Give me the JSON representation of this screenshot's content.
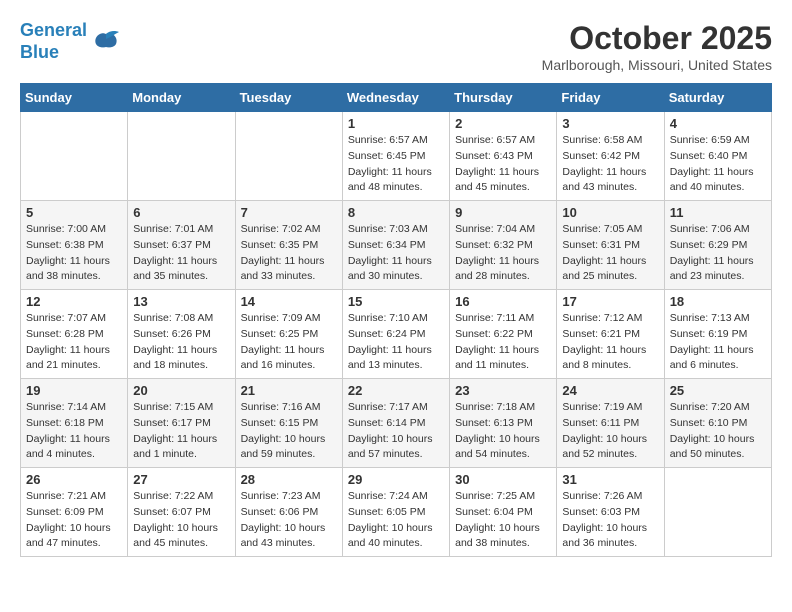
{
  "header": {
    "logo_line1": "General",
    "logo_line2": "Blue",
    "month": "October 2025",
    "location": "Marlborough, Missouri, United States"
  },
  "days_of_week": [
    "Sunday",
    "Monday",
    "Tuesday",
    "Wednesday",
    "Thursday",
    "Friday",
    "Saturday"
  ],
  "weeks": [
    [
      {
        "day": "",
        "info": ""
      },
      {
        "day": "",
        "info": ""
      },
      {
        "day": "",
        "info": ""
      },
      {
        "day": "1",
        "info": "Sunrise: 6:57 AM\nSunset: 6:45 PM\nDaylight: 11 hours\nand 48 minutes."
      },
      {
        "day": "2",
        "info": "Sunrise: 6:57 AM\nSunset: 6:43 PM\nDaylight: 11 hours\nand 45 minutes."
      },
      {
        "day": "3",
        "info": "Sunrise: 6:58 AM\nSunset: 6:42 PM\nDaylight: 11 hours\nand 43 minutes."
      },
      {
        "day": "4",
        "info": "Sunrise: 6:59 AM\nSunset: 6:40 PM\nDaylight: 11 hours\nand 40 minutes."
      }
    ],
    [
      {
        "day": "5",
        "info": "Sunrise: 7:00 AM\nSunset: 6:38 PM\nDaylight: 11 hours\nand 38 minutes."
      },
      {
        "day": "6",
        "info": "Sunrise: 7:01 AM\nSunset: 6:37 PM\nDaylight: 11 hours\nand 35 minutes."
      },
      {
        "day": "7",
        "info": "Sunrise: 7:02 AM\nSunset: 6:35 PM\nDaylight: 11 hours\nand 33 minutes."
      },
      {
        "day": "8",
        "info": "Sunrise: 7:03 AM\nSunset: 6:34 PM\nDaylight: 11 hours\nand 30 minutes."
      },
      {
        "day": "9",
        "info": "Sunrise: 7:04 AM\nSunset: 6:32 PM\nDaylight: 11 hours\nand 28 minutes."
      },
      {
        "day": "10",
        "info": "Sunrise: 7:05 AM\nSunset: 6:31 PM\nDaylight: 11 hours\nand 25 minutes."
      },
      {
        "day": "11",
        "info": "Sunrise: 7:06 AM\nSunset: 6:29 PM\nDaylight: 11 hours\nand 23 minutes."
      }
    ],
    [
      {
        "day": "12",
        "info": "Sunrise: 7:07 AM\nSunset: 6:28 PM\nDaylight: 11 hours\nand 21 minutes."
      },
      {
        "day": "13",
        "info": "Sunrise: 7:08 AM\nSunset: 6:26 PM\nDaylight: 11 hours\nand 18 minutes."
      },
      {
        "day": "14",
        "info": "Sunrise: 7:09 AM\nSunset: 6:25 PM\nDaylight: 11 hours\nand 16 minutes."
      },
      {
        "day": "15",
        "info": "Sunrise: 7:10 AM\nSunset: 6:24 PM\nDaylight: 11 hours\nand 13 minutes."
      },
      {
        "day": "16",
        "info": "Sunrise: 7:11 AM\nSunset: 6:22 PM\nDaylight: 11 hours\nand 11 minutes."
      },
      {
        "day": "17",
        "info": "Sunrise: 7:12 AM\nSunset: 6:21 PM\nDaylight: 11 hours\nand 8 minutes."
      },
      {
        "day": "18",
        "info": "Sunrise: 7:13 AM\nSunset: 6:19 PM\nDaylight: 11 hours\nand 6 minutes."
      }
    ],
    [
      {
        "day": "19",
        "info": "Sunrise: 7:14 AM\nSunset: 6:18 PM\nDaylight: 11 hours\nand 4 minutes."
      },
      {
        "day": "20",
        "info": "Sunrise: 7:15 AM\nSunset: 6:17 PM\nDaylight: 11 hours\nand 1 minute."
      },
      {
        "day": "21",
        "info": "Sunrise: 7:16 AM\nSunset: 6:15 PM\nDaylight: 10 hours\nand 59 minutes."
      },
      {
        "day": "22",
        "info": "Sunrise: 7:17 AM\nSunset: 6:14 PM\nDaylight: 10 hours\nand 57 minutes."
      },
      {
        "day": "23",
        "info": "Sunrise: 7:18 AM\nSunset: 6:13 PM\nDaylight: 10 hours\nand 54 minutes."
      },
      {
        "day": "24",
        "info": "Sunrise: 7:19 AM\nSunset: 6:11 PM\nDaylight: 10 hours\nand 52 minutes."
      },
      {
        "day": "25",
        "info": "Sunrise: 7:20 AM\nSunset: 6:10 PM\nDaylight: 10 hours\nand 50 minutes."
      }
    ],
    [
      {
        "day": "26",
        "info": "Sunrise: 7:21 AM\nSunset: 6:09 PM\nDaylight: 10 hours\nand 47 minutes."
      },
      {
        "day": "27",
        "info": "Sunrise: 7:22 AM\nSunset: 6:07 PM\nDaylight: 10 hours\nand 45 minutes."
      },
      {
        "day": "28",
        "info": "Sunrise: 7:23 AM\nSunset: 6:06 PM\nDaylight: 10 hours\nand 43 minutes."
      },
      {
        "day": "29",
        "info": "Sunrise: 7:24 AM\nSunset: 6:05 PM\nDaylight: 10 hours\nand 40 minutes."
      },
      {
        "day": "30",
        "info": "Sunrise: 7:25 AM\nSunset: 6:04 PM\nDaylight: 10 hours\nand 38 minutes."
      },
      {
        "day": "31",
        "info": "Sunrise: 7:26 AM\nSunset: 6:03 PM\nDaylight: 10 hours\nand 36 minutes."
      },
      {
        "day": "",
        "info": ""
      }
    ]
  ]
}
